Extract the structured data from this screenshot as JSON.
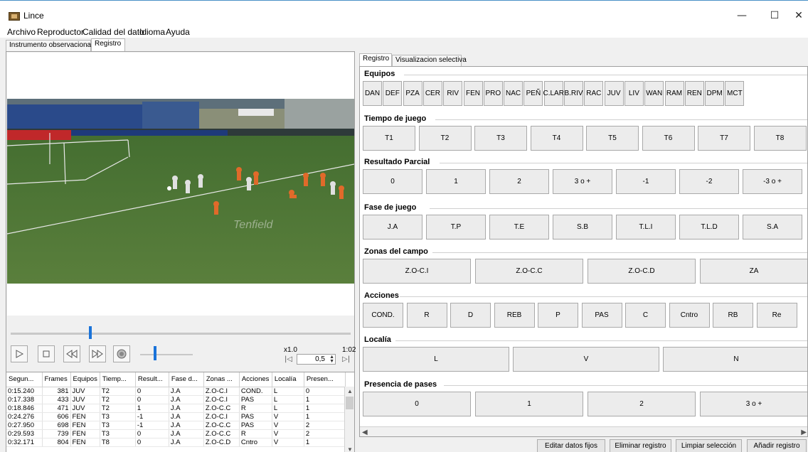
{
  "window": {
    "title": "Lince",
    "minimize_glyph": "—",
    "maximize_glyph": "☐",
    "close_glyph": "✕"
  },
  "menubar": [
    "Archivo",
    "Reproductor",
    "Calidad del dato",
    "Idioma",
    "Ayuda"
  ],
  "top_tabs": [
    {
      "label": "Instrumento observacional",
      "active": false
    },
    {
      "label": "Registro",
      "active": true
    }
  ],
  "player": {
    "timeline_position": 0.23,
    "volume_position": 0.25,
    "speed_label": "x1.0",
    "time_label": "1:02",
    "speed_value": "0,5",
    "icons": [
      "play-icon",
      "stop-icon",
      "rewind-icon",
      "fast-forward-icon",
      "volume-icon"
    ]
  },
  "table": {
    "columns": [
      "Segun...",
      "Frames",
      "Equipos",
      "Tiemp...",
      "Result...",
      "Fase d...",
      "Zonas ...",
      "Acciones",
      "Localía",
      "Presen..."
    ],
    "rows": [
      [
        "0:15.240",
        "381",
        "JUV",
        "T2",
        "0",
        "J.A",
        "Z.O-C.I",
        "COND.",
        "L",
        "0"
      ],
      [
        "0:17.338",
        "433",
        "JUV",
        "T2",
        "0",
        "J.A",
        "Z.O-C.I",
        "PAS",
        "L",
        "1"
      ],
      [
        "0:18.846",
        "471",
        "JUV",
        "T2",
        "1",
        "J.A",
        "Z.O-C.C",
        "R",
        "L",
        "1"
      ],
      [
        "0:24.276",
        "606",
        "FEN",
        "T3",
        "-1",
        "J.A",
        "Z.O-C.I",
        "PAS",
        "V",
        "1"
      ],
      [
        "0:27.950",
        "698",
        "FEN",
        "T3",
        "-1",
        "J.A",
        "Z.O-C.C",
        "PAS",
        "V",
        "2"
      ],
      [
        "0:29.593",
        "739",
        "FEN",
        "T3",
        "0",
        "J.A",
        "Z.O-C.C",
        "R",
        "V",
        "2"
      ],
      [
        "0:32.171",
        "804",
        "FEN",
        "T8",
        "0",
        "J.A",
        "Z.O-C.D",
        "Cntro",
        "V",
        "1"
      ]
    ]
  },
  "right_tabs": [
    {
      "label": "Registro",
      "active": true
    },
    {
      "label": "Visualizacion selectiva",
      "active": false
    }
  ],
  "sections": [
    {
      "title": "Equipos",
      "buttons": [
        "DAN",
        "DEF",
        "PZA",
        "CER",
        "RIV",
        "FEN",
        "PRO",
        "NAC",
        "PEÑ",
        "C.LAR",
        "B.RIV",
        "RAC",
        "JUV",
        "LIV",
        "WAN",
        "RAM",
        "REN",
        "DPM",
        "MCT"
      ]
    },
    {
      "title": "Tiempo de juego",
      "buttons": [
        "T1",
        "T2",
        "T3",
        "T4",
        "T5",
        "T6",
        "T7",
        "T8"
      ]
    },
    {
      "title": "Resultado Parcial",
      "buttons": [
        "0",
        "1",
        "2",
        "3 o +",
        "-1",
        "-2",
        "-3 o +"
      ]
    },
    {
      "title": "Fase de juego",
      "buttons": [
        "J.A",
        "T.P",
        "T.E",
        "S.B",
        "T.L.I",
        "T.L.D",
        "S.A"
      ]
    },
    {
      "title": "Zonas del campo",
      "buttons": [
        "Z.O-C.I",
        "Z.O-C.C",
        "Z.O-C.D",
        "ZA"
      ]
    },
    {
      "title": "Acciones",
      "buttons": [
        "COND.",
        "R",
        "D",
        "REB",
        "P",
        "PAS",
        "C",
        "Cntro",
        "RB",
        "Re"
      ]
    },
    {
      "title": "Localía",
      "buttons": [
        "L",
        "V",
        "N"
      ]
    },
    {
      "title": "Presencia de pases",
      "buttons": [
        "0",
        "1",
        "2",
        "3 o +"
      ]
    }
  ],
  "bottom_buttons": [
    "Editar datos fijos",
    "Eliminar registro",
    "Limpiar selección",
    "Añadir registro"
  ]
}
